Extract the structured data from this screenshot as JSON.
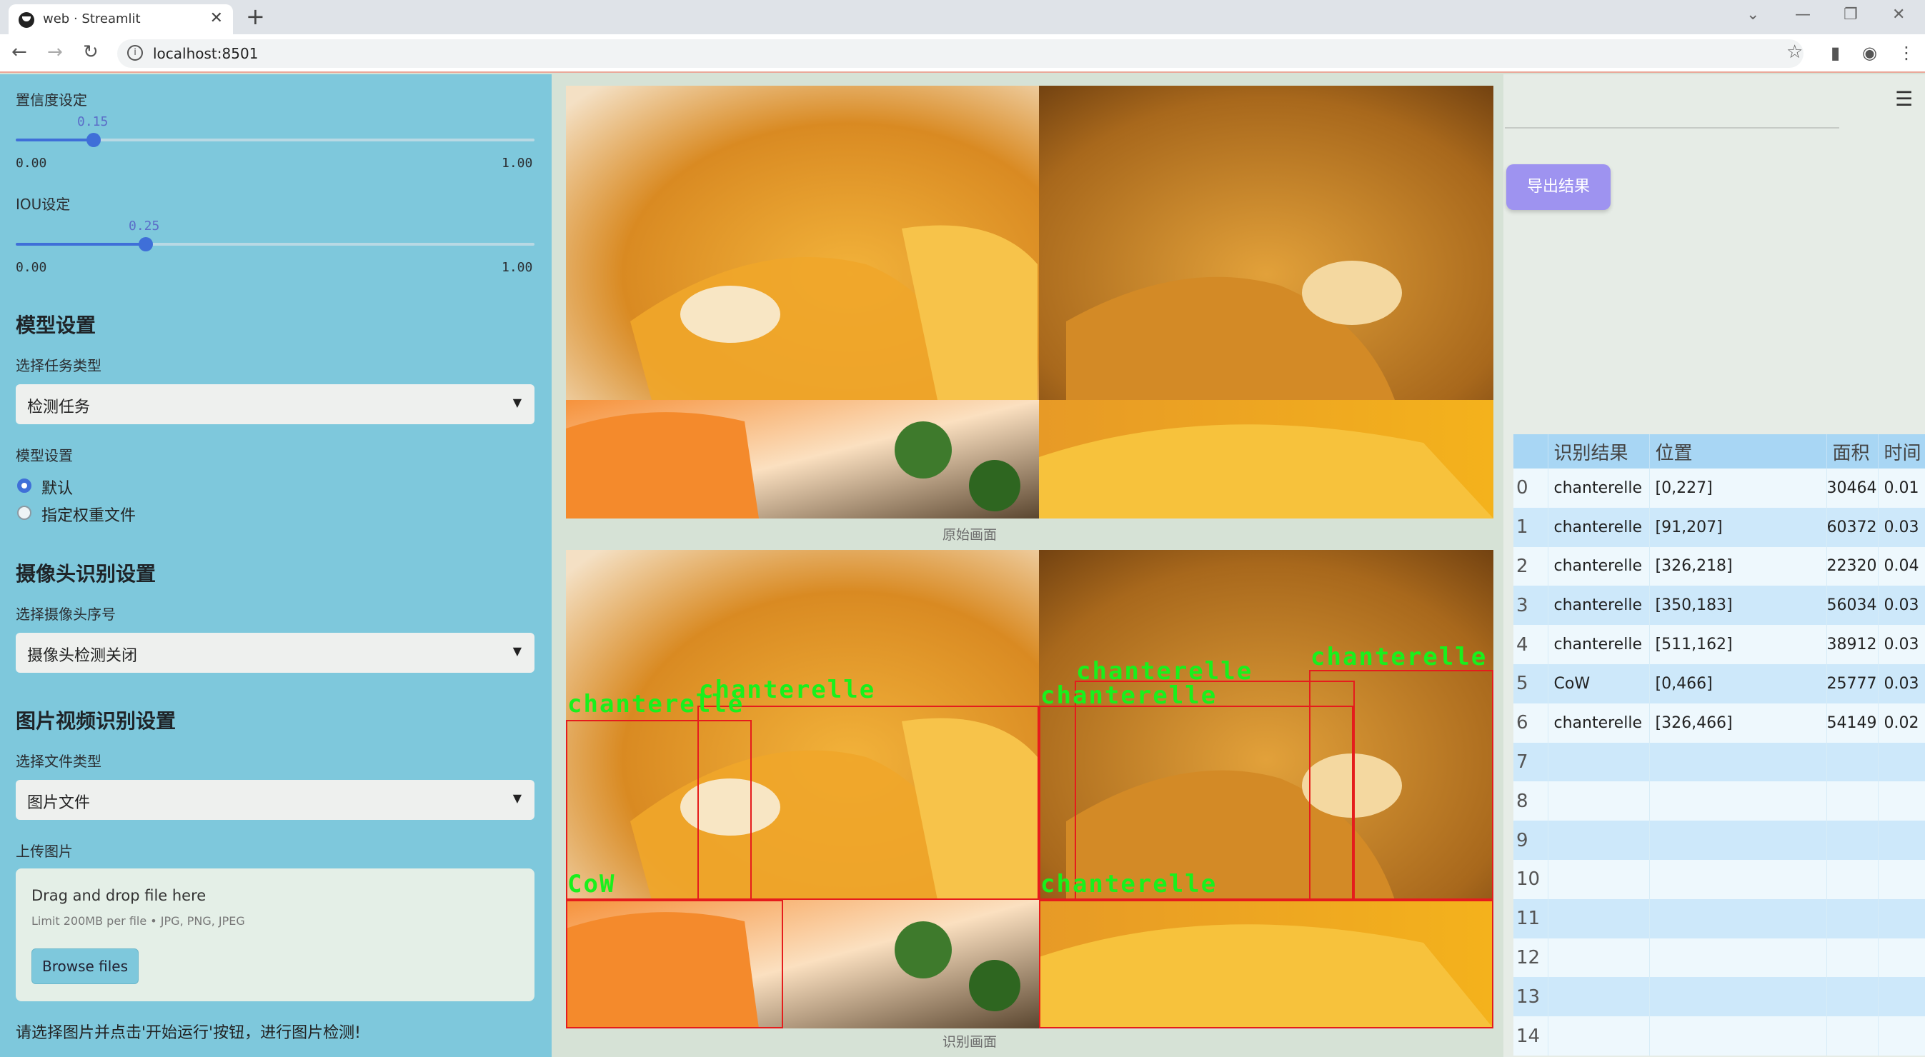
{
  "browser": {
    "tab_title": "web · Streamlit",
    "url": "localhost:8501"
  },
  "sidebar": {
    "confidence": {
      "label": "置信度设定",
      "value": "0.15",
      "min": "0.00",
      "max": "1.00",
      "fraction": 0.15
    },
    "iou": {
      "label": "IOU设定",
      "value": "0.25",
      "min": "0.00",
      "max": "1.00",
      "fraction": 0.25
    },
    "model_section": {
      "heading": "模型设置",
      "task_label": "选择任务类型",
      "task_value": "检测任务",
      "model_label": "模型设置",
      "options": [
        "默认",
        "指定权重文件"
      ],
      "selected_option": "默认"
    },
    "camera_section": {
      "heading": "摄像头识别设置",
      "camera_label": "选择摄像头序号",
      "camera_value": "摄像头检测关闭"
    },
    "media_section": {
      "heading": "图片视频识别设置",
      "filetype_label": "选择文件类型",
      "filetype_value": "图片文件",
      "upload_label": "上传图片",
      "drop_text": "Drag and drop file here",
      "limit_text": "Limit 200MB per file • JPG, PNG, JPEG",
      "browse_button": "Browse files"
    },
    "hint": "请选择图片并点击'开始运行'按钮，进行图片检测!"
  },
  "main": {
    "original_caption": "原始画面",
    "detected_caption": "识别画面",
    "detection_labels": [
      "chanterelle",
      "chanterelle",
      "CoW",
      "chanterelle",
      "chanterelle",
      "chanterelle",
      "chanterelle"
    ]
  },
  "right": {
    "export_button": "导出结果",
    "table": {
      "headers": [
        "",
        "识别结果",
        "位置",
        "面积",
        "时间"
      ],
      "rows": [
        {
          "idx": "0",
          "label": "chanterelle",
          "pos": "[0,227]",
          "area": "30464",
          "time": "0.01"
        },
        {
          "idx": "1",
          "label": "chanterelle",
          "pos": "[91,207]",
          "area": "60372",
          "time": "0.03"
        },
        {
          "idx": "2",
          "label": "chanterelle",
          "pos": "[326,218]",
          "area": "22320",
          "time": "0.04"
        },
        {
          "idx": "3",
          "label": "chanterelle",
          "pos": "[350,183]",
          "area": "56034",
          "time": "0.03"
        },
        {
          "idx": "4",
          "label": "chanterelle",
          "pos": "[511,162]",
          "area": "38912",
          "time": "0.03"
        },
        {
          "idx": "5",
          "label": "CoW",
          "pos": "[0,466]",
          "area": "25777",
          "time": "0.03"
        },
        {
          "idx": "6",
          "label": "chanterelle",
          "pos": "[326,466]",
          "area": "54149",
          "time": "0.02"
        },
        {
          "idx": "7",
          "label": "",
          "pos": "",
          "area": "",
          "time": ""
        },
        {
          "idx": "8",
          "label": "",
          "pos": "",
          "area": "",
          "time": ""
        },
        {
          "idx": "9",
          "label": "",
          "pos": "",
          "area": "",
          "time": ""
        },
        {
          "idx": "10",
          "label": "",
          "pos": "",
          "area": "",
          "time": ""
        },
        {
          "idx": "11",
          "label": "",
          "pos": "",
          "area": "",
          "time": ""
        },
        {
          "idx": "12",
          "label": "",
          "pos": "",
          "area": "",
          "time": ""
        },
        {
          "idx": "13",
          "label": "",
          "pos": "",
          "area": "",
          "time": ""
        },
        {
          "idx": "14",
          "label": "",
          "pos": "",
          "area": "",
          "time": ""
        }
      ]
    }
  }
}
